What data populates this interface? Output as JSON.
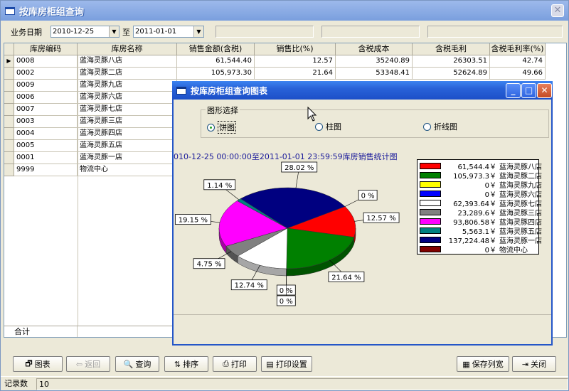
{
  "main": {
    "title": "按库房柜组查询",
    "filter": {
      "label": "业务日期",
      "date_from": "2010-12-25",
      "to_label": "至",
      "date_to": "2011-01-01"
    },
    "columns": [
      "库房编码",
      "库房名称",
      "销售金额(含税)",
      "销售比(%)",
      "含税成本",
      "含税毛利",
      "含税毛利率(%)"
    ],
    "rows": [
      {
        "code": "0008",
        "name": "蓝海灵豚八店",
        "amount": "61,544.40",
        "ratio": "12.57",
        "cost": "35240.89",
        "profit": "26303.51",
        "margin": "42.74"
      },
      {
        "code": "0002",
        "name": "蓝海灵豚二店",
        "amount": "105,973.30",
        "ratio": "21.64",
        "cost": "53348.41",
        "profit": "52624.89",
        "margin": "49.66"
      },
      {
        "code": "0009",
        "name": "蓝海灵豚九店"
      },
      {
        "code": "0006",
        "name": "蓝海灵豚六店"
      },
      {
        "code": "0007",
        "name": "蓝海灵豚七店"
      },
      {
        "code": "0003",
        "name": "蓝海灵豚三店"
      },
      {
        "code": "0004",
        "name": "蓝海灵豚四店"
      },
      {
        "code": "0005",
        "name": "蓝海灵豚五店"
      },
      {
        "code": "0001",
        "name": "蓝海灵豚一店"
      },
      {
        "code": "9999",
        "name": "物流中心"
      }
    ],
    "total_label": "合计",
    "buttons": {
      "chart": "图表",
      "back": "返回",
      "query": "查询",
      "sort": "排序",
      "print": "打印",
      "print_setup": "打印设置",
      "save_width": "保存列宽",
      "close": "关闭"
    },
    "status": {
      "label": "记录数",
      "count": "10"
    }
  },
  "dialog": {
    "title": "按库房柜组查询图表",
    "group_label": "图形选择",
    "options": [
      "饼图",
      "柱图",
      "折线图"
    ],
    "selected": "饼图",
    "chart_title": "010-12-25 00:00:00至2011-01-01 23:59:59库房销售统计图"
  },
  "chart_data": {
    "type": "pie",
    "title": "010-12-25 00:00:00至2011-01-01 23:59:59库房销售统计图",
    "slices": [
      {
        "label": "蓝海灵豚八店",
        "value": 61544.4,
        "value_text": "61,544.4￥",
        "pct": 12.57,
        "pct_text": "12.57 %",
        "color": "#ff0000"
      },
      {
        "label": "蓝海灵豚二店",
        "value": 105973.3,
        "value_text": "105,973.3￥",
        "pct": 21.64,
        "pct_text": "21.64 %",
        "color": "#008000"
      },
      {
        "label": "蓝海灵豚九店",
        "value": 0,
        "value_text": "0￥",
        "pct": 0,
        "pct_text": "0 %",
        "color": "#ffff00"
      },
      {
        "label": "蓝海灵豚六店",
        "value": 0,
        "value_text": "0￥",
        "pct": 0,
        "pct_text": "0 %",
        "color": "#0000ff"
      },
      {
        "label": "蓝海灵豚七店",
        "value": 62393.64,
        "value_text": "62,393.64￥",
        "pct": 12.74,
        "pct_text": "12.74 %",
        "color": "#ffffff"
      },
      {
        "label": "蓝海灵豚三店",
        "value": 23289.6,
        "value_text": "23,289.6￥",
        "pct": 4.75,
        "pct_text": "4.75 %",
        "color": "#808080"
      },
      {
        "label": "蓝海灵豚四店",
        "value": 93806.58,
        "value_text": "93,806.58￥",
        "pct": 19.15,
        "pct_text": "19.15 %",
        "color": "#ff00ff"
      },
      {
        "label": "蓝海灵豚五店",
        "value": 5563.1,
        "value_text": "5,563.1￥",
        "pct": 1.14,
        "pct_text": "1.14 %",
        "color": "#008080"
      },
      {
        "label": "蓝海灵豚一店",
        "value": 137224.48,
        "value_text": "137,224.48￥",
        "pct": 28.02,
        "pct_text": "28.02 %",
        "color": "#000080"
      },
      {
        "label": "物流中心",
        "value": 0,
        "value_text": "0￥",
        "pct": 0,
        "pct_text": "0 %",
        "color": "#800000"
      }
    ],
    "legend_position": "right"
  }
}
